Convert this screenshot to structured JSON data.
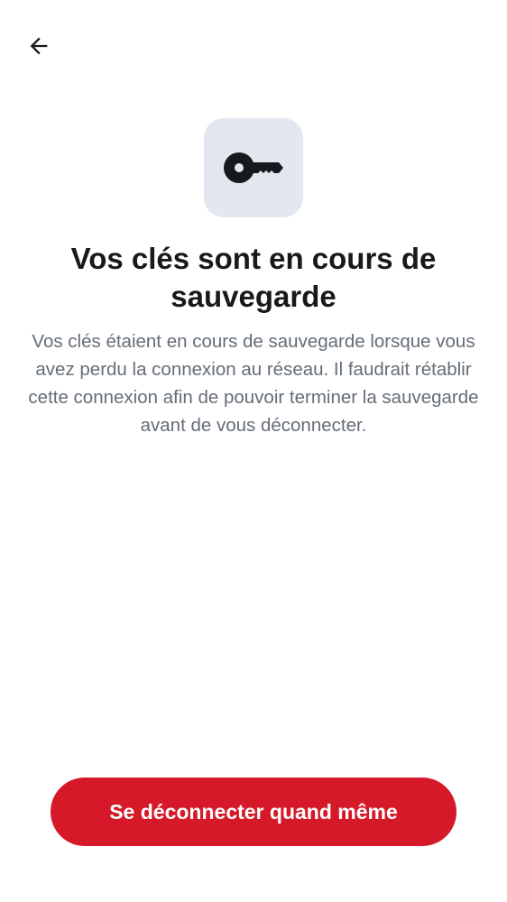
{
  "header": {
    "back_icon": "arrow-left-icon"
  },
  "illustration": {
    "icon": "key-icon",
    "tile_color": "#e3e8f0",
    "icon_color": "#17191c"
  },
  "content": {
    "title": "Vos clés sont en cours de sauvegarde",
    "description": "Vos clés étaient en cours de sauvegarde lorsque vous avez perdu la connexion au réseau. Il faudrait rétablir cette connexion afin de pouvoir terminer la sauvegarde avant de vous déconnecter."
  },
  "actions": {
    "sign_out_label": "Se déconnecter quand même",
    "sign_out_color": "#d51928"
  }
}
